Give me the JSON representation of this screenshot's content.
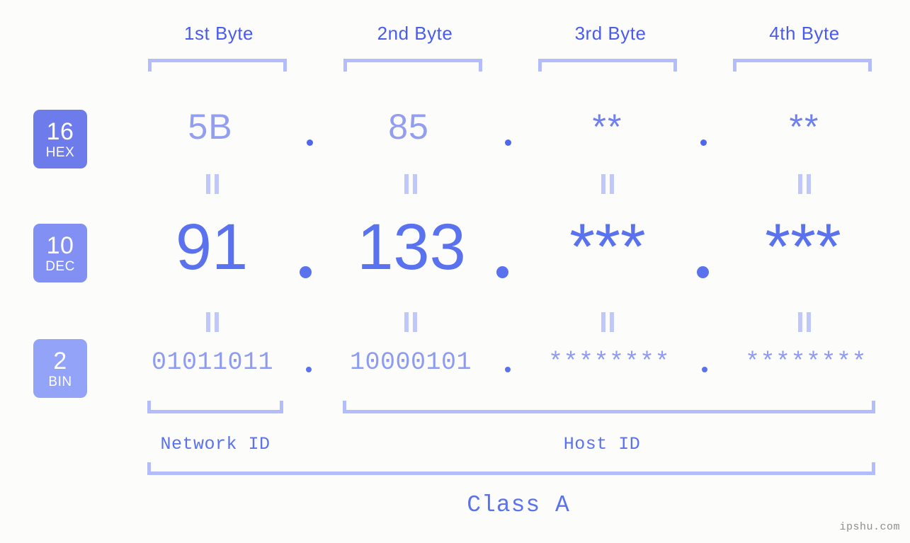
{
  "page": {
    "background_color": "#fcfdfa",
    "watermark": "ipshu.com"
  },
  "colors": {
    "byte_label": "#4a5bf0",
    "bracket": "#b4bdfb",
    "hex_value": "#949ef0",
    "hex_star": "#6f80f0",
    "dec_value": "#5a72ee",
    "bin_value": "#8e9bf3",
    "dot": "#5a72ee",
    "equals": "#c0c8fb",
    "badge_hex": "#6d7cea",
    "badge_dec": "#8190f2",
    "badge_bin": "#92a3f8",
    "watermark": "#8e8e8e"
  },
  "header": {
    "bytes": [
      {
        "label": "1st Byte"
      },
      {
        "label": "2nd Byte"
      },
      {
        "label": "3rd Byte"
      },
      {
        "label": "4th Byte"
      }
    ]
  },
  "radix_badges": [
    {
      "number": "16",
      "name": "HEX"
    },
    {
      "number": "10",
      "name": "DEC"
    },
    {
      "number": "2",
      "name": "BIN"
    }
  ],
  "rows": {
    "hex": {
      "values": [
        "5B",
        "85",
        "**",
        "**"
      ],
      "separators": [
        ".",
        ".",
        "."
      ]
    },
    "dec": {
      "values": [
        "91",
        "133",
        "***",
        "***"
      ],
      "separators": [
        ".",
        ".",
        "."
      ]
    },
    "bin": {
      "values": [
        "01011011",
        "10000101",
        "********",
        "********"
      ],
      "separators": [
        ".",
        ".",
        "."
      ]
    }
  },
  "equality_separator": "||",
  "footer": {
    "network_id_label": "Network ID",
    "host_id_label": "Host ID",
    "class_label": "Class A"
  }
}
